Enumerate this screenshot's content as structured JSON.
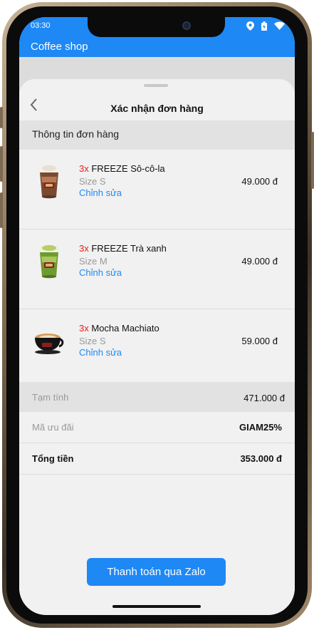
{
  "status": {
    "time": "03:30"
  },
  "app": {
    "title": "Coffee shop"
  },
  "sheet": {
    "title": "Xác nhận đơn hàng",
    "section_label": "Thông tin đơn hàng",
    "items": [
      {
        "qty": "3x",
        "name": "FREEZE Sô-cô-la",
        "size": "Size S",
        "edit": "Chỉnh sửa",
        "price": "49.000 đ"
      },
      {
        "qty": "3x",
        "name": "FREEZE Trà xanh",
        "size": "Size M",
        "edit": "Chỉnh sửa",
        "price": "49.000 đ"
      },
      {
        "qty": "3x",
        "name": "Mocha Machiato",
        "size": "Size S",
        "edit": "Chỉnh sửa",
        "price": "59.000 đ"
      }
    ],
    "subtotal": {
      "label": "Tạm tính",
      "value": "471.000 đ"
    },
    "voucher": {
      "label": "Mã ưu đãi",
      "value": "GIAM25%"
    },
    "total": {
      "label": "Tổng tiền",
      "value": "353.000 đ"
    },
    "pay_button": "Thanh toán qua Zalo"
  },
  "colors": {
    "primary": "#1e88f5",
    "qty": "#e02020",
    "muted": "#999999"
  }
}
